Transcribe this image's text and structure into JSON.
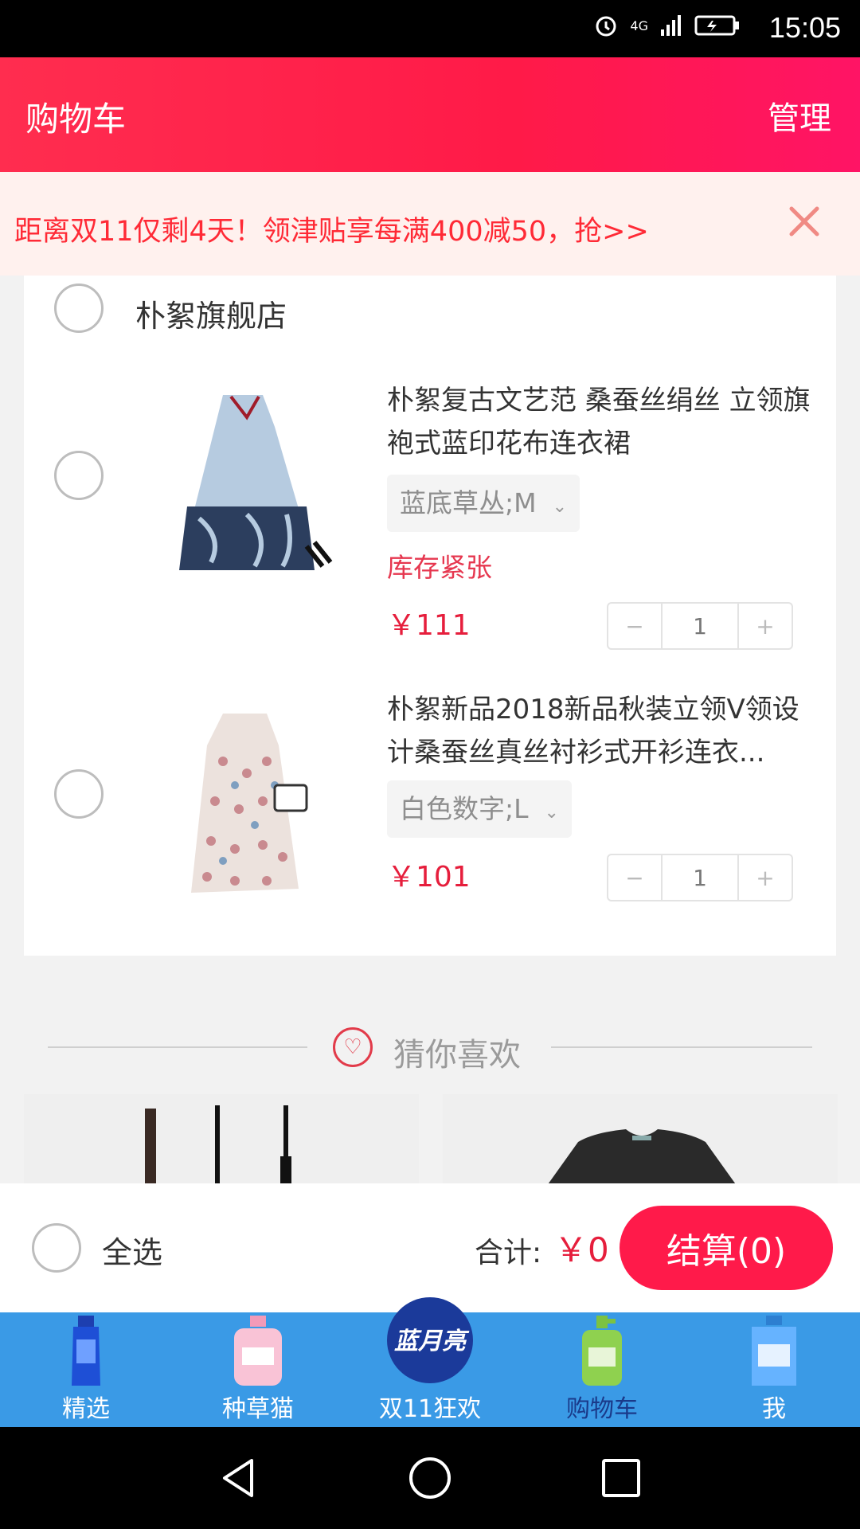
{
  "status_bar": {
    "time": "15:05",
    "network": "4G"
  },
  "header": {
    "title": "购物车",
    "manage": "管理"
  },
  "promo": {
    "text": "距离双11仅剩4天！领津贴享每满400减50，抢>>"
  },
  "store": {
    "name": "朴絮旗舰店"
  },
  "items": [
    {
      "title": "朴絮复古文艺范 桑蚕丝绢丝 立领旗袍式蓝印花布连衣裙",
      "sku": "蓝底草丛;M",
      "stock": "库存紧张",
      "price": "￥111",
      "qty": "1",
      "minus": "−",
      "plus": "+"
    },
    {
      "title": "朴絮新品2018新品秋装立领V领设计桑蚕丝真丝衬衫式开衫连衣...",
      "sku": "白色数字;L",
      "price": "￥101",
      "qty": "1",
      "minus": "−",
      "plus": "+"
    }
  ],
  "recommend": {
    "label": "猜你喜欢"
  },
  "checkout": {
    "select_all": "全选",
    "total_label": "合计:",
    "total_value": "￥0",
    "button": "结算(0)"
  },
  "tabs": [
    {
      "label": "精选",
      "icon": "blue-bottle-icon"
    },
    {
      "label": "种草猫",
      "icon": "pink-bottle-icon"
    },
    {
      "label": "双11狂欢",
      "icon": "brand-logo-icon",
      "logo_text": "蓝月亮"
    },
    {
      "label": "购物车",
      "icon": "green-pump-bottle-icon",
      "active": true
    },
    {
      "label": "我",
      "icon": "detergent-bottle-icon"
    }
  ],
  "colors": {
    "accent": "#ff1a4a",
    "price": "#e61e3c",
    "tabbar": "#3a9ae6"
  }
}
